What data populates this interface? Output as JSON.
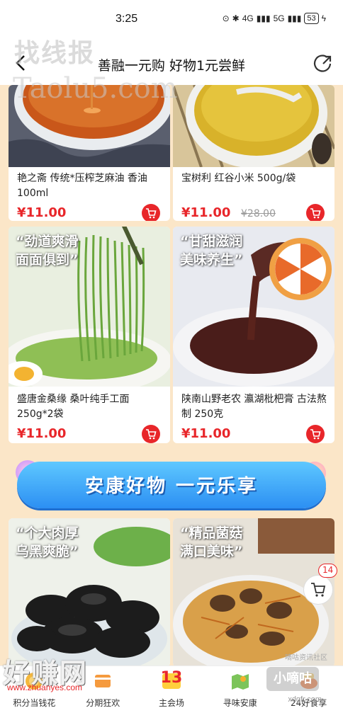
{
  "status_bar": {
    "time": "3:25",
    "signal_1": "4G",
    "signal_2": "5G",
    "battery": "53"
  },
  "watermarks": {
    "top": "找线报",
    "url": "Taolu5.com",
    "bottom_left": "好赚网",
    "bottom_left_sub": "www.zhuanyes.com",
    "bottom_right": "小嘀咕",
    "bottom_right_url": "xdgfr.com",
    "bottom_right_small": "嘀咕资讯社区"
  },
  "header": {
    "title": "善融一元购 好物1元尝鲜"
  },
  "products": [
    {
      "name": "艳之斋 传统*压榨芝麻油 香油100ml",
      "price": "¥11.00",
      "original_price": ""
    },
    {
      "name": "宝树利 红谷小米 500g/袋",
      "price": "¥11.00",
      "original_price": "¥28.00"
    },
    {
      "name": "盛唐金桑缘 桑叶纯手工面 250g*2袋",
      "price": "¥11.00",
      "original_price": "",
      "slogan_1": "“劲道爽滑",
      "slogan_2": "面面俱到”"
    },
    {
      "name": "陕南山野老农 瀛湖枇杷膏 古法熬制 250克",
      "price": "¥11.00",
      "original_price": "",
      "slogan_1": "“甘甜滋润",
      "slogan_2": "美味养生”"
    },
    {
      "slogan_1": "“个大肉厚",
      "slogan_2": "乌黑爽脆”"
    },
    {
      "slogan_1": "“精品菌菇",
      "slogan_2": "满口美味”"
    }
  ],
  "banner": {
    "text": "安康好物 一元乐享"
  },
  "float_cart": {
    "count": "14"
  },
  "bottom_nav": [
    {
      "label": "积分当钱花",
      "icon": "points-icon"
    },
    {
      "label": "分期狂欢",
      "icon": "installment-icon"
    },
    {
      "label": "主会场",
      "icon": "main-venue-icon",
      "badge": "13"
    },
    {
      "label": "寻味安康",
      "icon": "map-icon"
    },
    {
      "label": "24好食享",
      "icon": "food-icon"
    }
  ],
  "colors": {
    "accent": "#e8262a",
    "background": "#fbe6c8",
    "banner": "#2c8ff3"
  }
}
